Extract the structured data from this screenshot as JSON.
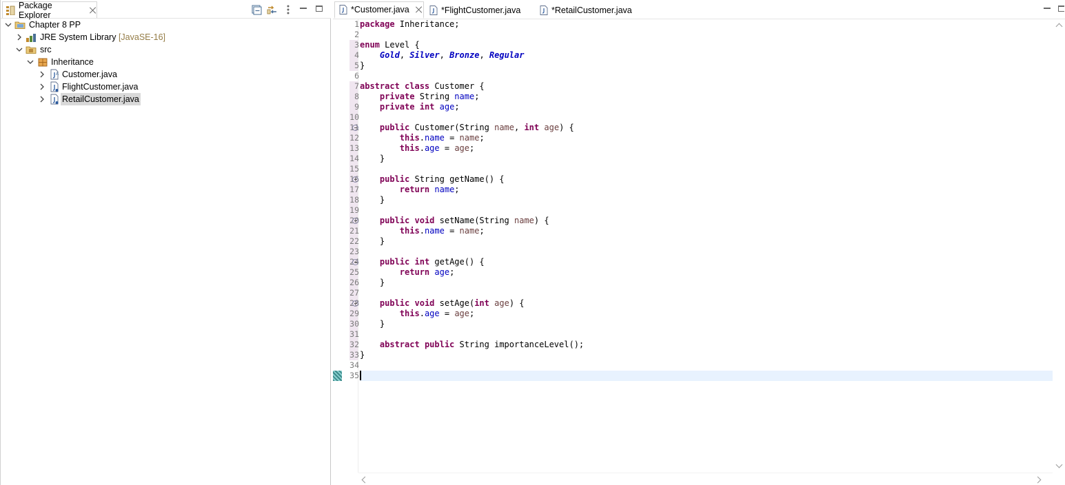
{
  "package_explorer": {
    "tab_label": "Package Explorer",
    "toolbar_icons": [
      "collapse-all-icon",
      "link-with-editor-icon",
      "view-menu-icon",
      "minimize-icon",
      "maximize-icon"
    ],
    "tree": [
      {
        "label": "Chapter 8 PP",
        "decor": "",
        "icon": "project-icon",
        "expanded": true,
        "selected": false
      },
      {
        "label": "JRE System Library",
        "decor": "[JavaSE-16]",
        "icon": "library-icon",
        "expanded": false,
        "selected": false
      },
      {
        "label": "src",
        "decor": "",
        "icon": "source-folder-icon",
        "expanded": true,
        "selected": false
      },
      {
        "label": "Inheritance",
        "decor": "",
        "icon": "package-icon",
        "expanded": true,
        "selected": false
      },
      {
        "label": "Customer.java",
        "decor": "",
        "icon": "java-file-icon",
        "expanded": false,
        "selected": false
      },
      {
        "label": "FlightCustomer.java",
        "decor": "",
        "icon": "java-file-icon",
        "expanded": false,
        "selected": false
      },
      {
        "label": "RetailCustomer.java",
        "decor": "",
        "icon": "java-file-icon",
        "expanded": false,
        "selected": true
      }
    ]
  },
  "editor": {
    "tabs": [
      {
        "label": "*Customer.java",
        "active": true
      },
      {
        "label": "*FlightCustomer.java",
        "active": false
      },
      {
        "label": "*RetailCustomer.java",
        "active": false
      }
    ],
    "current_line": 35,
    "line_numbers": [
      "1",
      "2",
      "3",
      "4",
      "5",
      "6",
      "7",
      "8",
      "9",
      "10",
      "11",
      "12",
      "13",
      "14",
      "15",
      "16",
      "17",
      "18",
      "19",
      "20",
      "21",
      "22",
      "23",
      "24",
      "25",
      "26",
      "27",
      "28",
      "29",
      "30",
      "31",
      "32",
      "33",
      "34",
      "35"
    ],
    "code_lines": [
      "package Inheritance;",
      "",
      "enum Level {",
      "    Gold, Silver, Bronze, Regular",
      "}",
      "",
      "abstract class Customer {",
      "    private String name;",
      "    private int age;",
      "",
      "    public Customer(String name, int age) {",
      "        this.name = name;",
      "        this.age = age;",
      "    }",
      "",
      "    public String getName() {",
      "        return name;",
      "    }",
      "",
      "    public void setName(String name) {",
      "        this.name = name;",
      "    }",
      "",
      "    public int getAge() {",
      "        return age;",
      "    }",
      "",
      "    public void setAge(int age) {",
      "        this.age = age;",
      "    }",
      "",
      "    abstract public String importanceLevel();",
      "}",
      "",
      ""
    ],
    "fold_lines": [
      11,
      16,
      20,
      24,
      28
    ],
    "occurrence_lines": [
      3,
      4,
      5,
      7,
      8,
      9,
      10,
      11,
      12,
      13,
      14,
      15,
      16,
      17,
      18,
      19,
      20,
      21,
      22,
      23,
      24,
      25,
      26,
      27,
      28,
      29,
      30,
      31,
      32,
      33
    ]
  },
  "colors": {
    "keyword": "#7f0055",
    "field": "#0000c0",
    "parameter": "#6a3e3e",
    "current_line": "#e8f2fe",
    "selection": "#d9d9d9"
  }
}
